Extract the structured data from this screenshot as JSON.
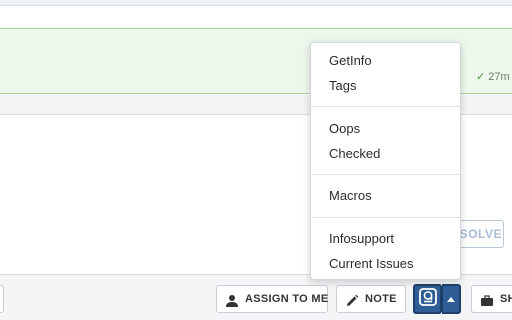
{
  "conversation": {
    "message_status_time": "27m"
  },
  "composer": {
    "resolve_label": "RESOLVE"
  },
  "toolbar": {
    "assign_label": "ASSIGN TO ME",
    "note_label": "NOTE",
    "sh_label": "SH"
  },
  "app_menu": {
    "items": [
      {
        "label": "GetInfo"
      },
      {
        "label": "Tags"
      },
      {
        "label": "Oops"
      },
      {
        "label": "Checked"
      },
      {
        "label": "Macros"
      },
      {
        "label": "Infosupport"
      },
      {
        "label": "Current Issues"
      }
    ]
  },
  "colors": {
    "accent": "#2f5d96",
    "success_bg": "#eef7ec",
    "success_border": "#a8d29c"
  },
  "icons": {
    "check": "check-icon",
    "person": "person-icon",
    "pencil": "pencil-icon",
    "app": "app-logo-icon",
    "caret": "caret-up-icon",
    "briefcase": "briefcase-icon"
  }
}
